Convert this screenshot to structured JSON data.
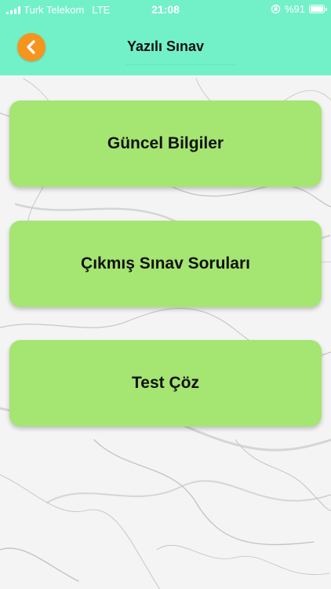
{
  "status_bar": {
    "carrier": "Turk Telekom",
    "network": "LTE",
    "time": "21:08",
    "battery_text": "%91",
    "battery_level": 0.91
  },
  "header": {
    "title": "Yazılı Sınav",
    "back_icon": "chevron-left-icon",
    "back_color": "#f6951e",
    "background_color": "#72f1c8"
  },
  "menu": {
    "card_color": "#a5e572",
    "items": [
      {
        "label": "Güncel Bilgiler"
      },
      {
        "label": "Çıkmış Sınav Soruları"
      },
      {
        "label": "Test Çöz"
      }
    ]
  }
}
